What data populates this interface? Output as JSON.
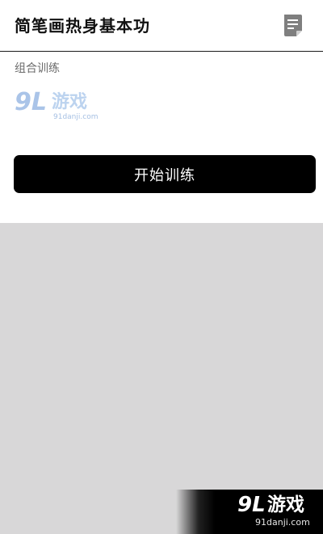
{
  "header": {
    "title": "简笔画热身基本功",
    "doc_icon": "document-icon"
  },
  "section": {
    "label": "组合训练"
  },
  "logo": {
    "number": "9L",
    "name": "游戏",
    "domain": "91danji.com"
  },
  "actions": {
    "start_label": "开始训练"
  },
  "watermark": {
    "number": "9L",
    "name": "游戏",
    "domain": "91danji.com"
  },
  "colors": {
    "background": "#d8d7d8",
    "panel": "#ffffff",
    "button": "#000000",
    "button_text": "#ffffff",
    "logo_blue": "#aac4e8"
  }
}
